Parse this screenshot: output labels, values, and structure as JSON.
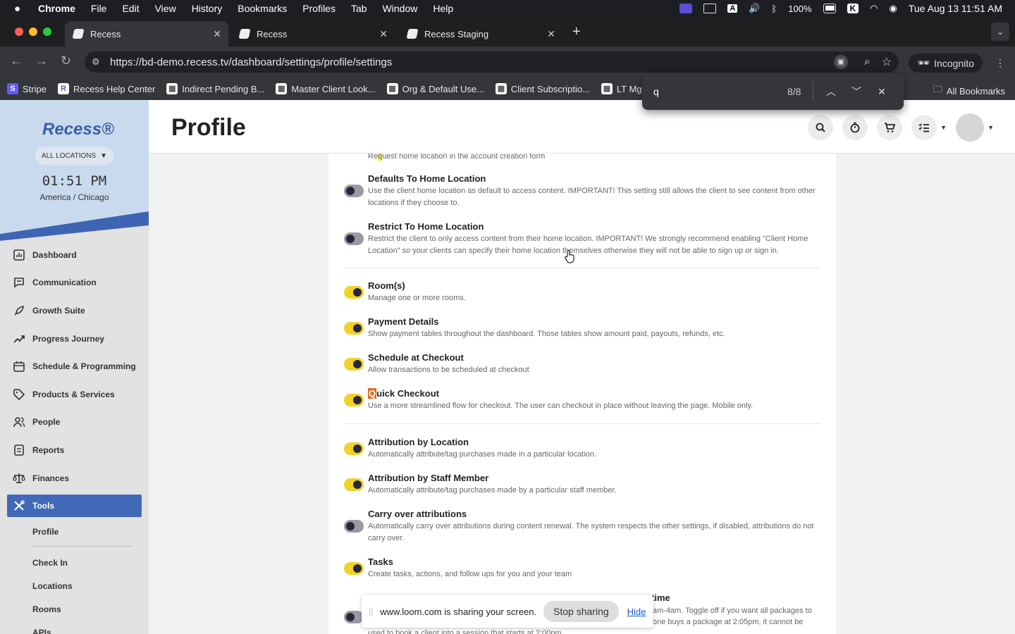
{
  "menubar": {
    "app": "Chrome",
    "items": [
      "File",
      "Edit",
      "View",
      "History",
      "Bookmarks",
      "Profiles",
      "Tab",
      "Window",
      "Help"
    ],
    "battery": "100%",
    "datetime": "Tue Aug 13  11:51 AM"
  },
  "tabs": [
    {
      "title": "Recess"
    },
    {
      "title": "Recess"
    },
    {
      "title": "Recess Staging"
    }
  ],
  "toolbar": {
    "url": "https://bd-demo.recess.tv/dashboard/settings/profile/settings",
    "incognito_label": "Incognito"
  },
  "bookmarks": {
    "items": [
      {
        "label": "Stripe",
        "icon": "S",
        "color": "#635bff"
      },
      {
        "label": "Recess Help Center",
        "icon": "R",
        "color": "#4a6fb5"
      },
      {
        "label": "Indirect Pending B...",
        "icon": "▦",
        "color": "#ffffff"
      },
      {
        "label": "Master Client Look...",
        "icon": "▦",
        "color": "#ffffff"
      },
      {
        "label": "Org & Default Use...",
        "icon": "▦",
        "color": "#ffffff"
      },
      {
        "label": "Client Subscriptio...",
        "icon": "▦",
        "color": "#ffffff"
      },
      {
        "label": "LT Mgr",
        "icon": "▦",
        "color": "#ffffff"
      }
    ],
    "all_label": "All Bookmarks"
  },
  "findbar": {
    "query": "q",
    "count": "8/8"
  },
  "sidebar": {
    "logo": "Recess®",
    "location_button": "ALL LOCATIONS",
    "clock": "01:51 PM",
    "timezone": "America / Chicago",
    "nav": [
      {
        "label": "Dashboard",
        "icon": "chart"
      },
      {
        "label": "Communication",
        "icon": "chat"
      },
      {
        "label": "Growth Suite",
        "icon": "rocket"
      },
      {
        "label": "Progress Journey",
        "icon": "trend"
      },
      {
        "label": "Schedule & Programming",
        "icon": "calendar"
      },
      {
        "label": "Products & Services",
        "icon": "tag"
      },
      {
        "label": "People",
        "icon": "people"
      },
      {
        "label": "Reports",
        "icon": "doc"
      },
      {
        "label": "Finances",
        "icon": "scale"
      }
    ],
    "active": "Tools",
    "subnav": [
      "Profile",
      "Check In",
      "Locations",
      "Rooms",
      "APIs"
    ]
  },
  "header": {
    "title": "Profile"
  },
  "settings": {
    "partial_top": "Request home location in the account creation form",
    "rows": [
      {
        "title": "Defaults To Home Location",
        "desc": "Use the client home location as default to access content. IMPORTANT! This setting still allows the client to see content from other locations if they choose to.",
        "on": false
      },
      {
        "title": "Restrict To Home Location",
        "desc": "Restrict the client to only access content from their home location. IMPORTANT! We strongly recommend enabling \"Client Home Location\" so your clients can specify their home location themselves otherwise they will not be able to sign up or sign in.",
        "on": false
      },
      {
        "title": "Room(s)",
        "desc": "Manage one or more rooms.",
        "on": true
      },
      {
        "title": "Payment Details",
        "desc": "Show payment tables throughout the dashboard. Those tables show amount paid, payouts, refunds, etc.",
        "on": true
      },
      {
        "title": "Schedule at Checkout",
        "desc": "Allow transactions to be scheduled at checkout",
        "on": true
      },
      {
        "title": "Quick Checkout",
        "desc": "Use a more streamlined flow for checkout. The user can checkout in place without leaving the page. Mobile only.",
        "on": true
      },
      {
        "title": "Attribution by Location",
        "desc": "Automatically attribute/tag purchases made in a particular location.",
        "on": true
      },
      {
        "title": "Attribution by Staff Member",
        "desc": "Automatically attribute/tag purchases made by a particular staff member.",
        "on": true
      },
      {
        "title": "Carry over attributions",
        "desc": "Automatically carry over attributions during content renewal. The system respects the other settings, if disabled, attributions do not carry over.",
        "on": false
      },
      {
        "title": "Tasks",
        "desc": "Create tasks, actions, and follow ups for you and your team",
        "on": true
      }
    ],
    "partial_bottom_title": "time",
    "partial_bottom_desc_1": "am-4am. Toggle off if you want all packages to",
    "partial_bottom_desc_2": "one buys a package at 2:05pm, it cannot be",
    "partial_bottom_desc_3": "used to book a client into a session that starts at 2:00pm"
  },
  "loom": {
    "message": "www.loom.com is sharing your screen.",
    "stop": "Stop sharing",
    "hide": "Hide"
  },
  "colors": {
    "accent": "#4268b8",
    "toggle_on": "#f2d128",
    "toggle_off": "#9a9aa2"
  }
}
